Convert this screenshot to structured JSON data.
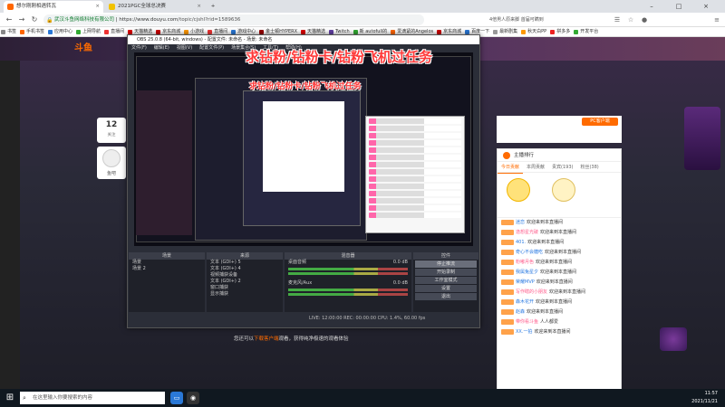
{
  "browser": {
    "tabs": [
      {
        "label": "想尔刚刚相遇转瓦"
      },
      {
        "label": "2021PGC全球总决赛"
      }
    ],
    "url": {
      "site": "武汉斗鱼网络科技有限公司",
      "domain": "https://www.douyu.com",
      "path": "/topic/cjshl?rid=1589636"
    },
    "search_text": "4倍男人原来脚 首届可瞒到",
    "bookmarks": [
      "书签",
      "手机书签",
      "应用中心",
      "上网导航",
      "直播间",
      "天猫精选",
      "京东商城",
      "小游戏",
      "直播间",
      "游戏中心",
      "金士顿HYPERX",
      "天猫精选",
      "Twitch",
      "新 autofull的",
      "爱滴紧的Angelos",
      "京东商城",
      "百度一下",
      "最新剧集",
      "秋天白PP",
      "拼多多",
      "开发平台"
    ]
  },
  "header": {
    "logo": "斗鱼"
  },
  "left": {
    "count": "12",
    "count_label": "关注",
    "avatar_name": "鱼吧"
  },
  "obs": {
    "title": "OBS 25.0.8 (64-bit, windows) - 配置文件: 未命名 - 场景: 未命名",
    "menu": [
      "文件(F)",
      "编辑(E)",
      "视图(V)",
      "配置文件(P)",
      "场景集合(S)",
      "工具(T)",
      "帮助(H)"
    ],
    "banner": "求钻粉/钻粉卡/钻粉飞机过任务",
    "banner_small": "求钻粉/钻粉卡/钻粉飞机过任务",
    "docks": {
      "scenes": {
        "title": "场景",
        "items": [
          "场景",
          "场景 2"
        ]
      },
      "sources": {
        "title": "来源",
        "items": [
          "文本 (GDI+) 5",
          "文本 (GDI+) 4",
          "视频捕获设备",
          "文本 (GDI+) 2",
          "窗口捕获",
          "显示捕获"
        ]
      },
      "mixer": {
        "title": "混音器",
        "tracks": [
          {
            "name": "桌面音频",
            "db": "0.0 dB"
          },
          {
            "name": "麦克风/Aux",
            "db": "0.0 dB"
          }
        ]
      },
      "controls": {
        "title": "控件",
        "buttons": [
          "停止推流",
          "开始录制",
          "工作室模式",
          "设置",
          "退出"
        ]
      },
      "transitions": {
        "title": "转场",
        "label": "场景转场"
      }
    },
    "status": "LIVE: 12:00:00  REC: 00:00:00  CPU: 1.4%, 60.00 fps"
  },
  "tip": {
    "prefix": "您还可以",
    "link": "下载客户端",
    "suffix": "观看，获得纯净极速的观看体验"
  },
  "right": {
    "pc_button": "PC客户端",
    "panel_title": "主播排行",
    "tabs": [
      "今日贡献",
      "本周贡献",
      "贵宾(193)",
      "粉丝(38)"
    ],
    "rank_names": [
      "1",
      "2",
      "3"
    ],
    "messages": [
      {
        "name": "迷恋",
        "text": "欢迎来到本直播间"
      },
      {
        "name": "逸想星光破",
        "text": "欢迎来到本直播间"
      },
      {
        "name": "401.",
        "text": "欢迎来到本直播间"
      },
      {
        "name": "奇心不会糖吃",
        "text": "欢迎来到本直播间"
      },
      {
        "name": "粉嘟月色",
        "text": "欢迎来到本直播间"
      },
      {
        "name": "我属兔星夕",
        "text": "欢迎来到本直播间"
      },
      {
        "name": "荣耀MVP",
        "text": "欢迎来到本直播间"
      },
      {
        "name": "写作瞎的小朋友",
        "text": "欢迎来到本直播间"
      },
      {
        "name": "森木花开",
        "text": "欢迎来到本直播间"
      },
      {
        "name": "赵森",
        "text": "欢迎来到本直播间"
      },
      {
        "name": "带你看斗鱼",
        "text": "人人都爱"
      },
      {
        "name": "XX.一拍",
        "text": "欢迎来到本直播间"
      }
    ]
  },
  "taskbar": {
    "search": "在这里输入你要搜索的内容",
    "time": "11:57",
    "date": "2021/11/21"
  }
}
